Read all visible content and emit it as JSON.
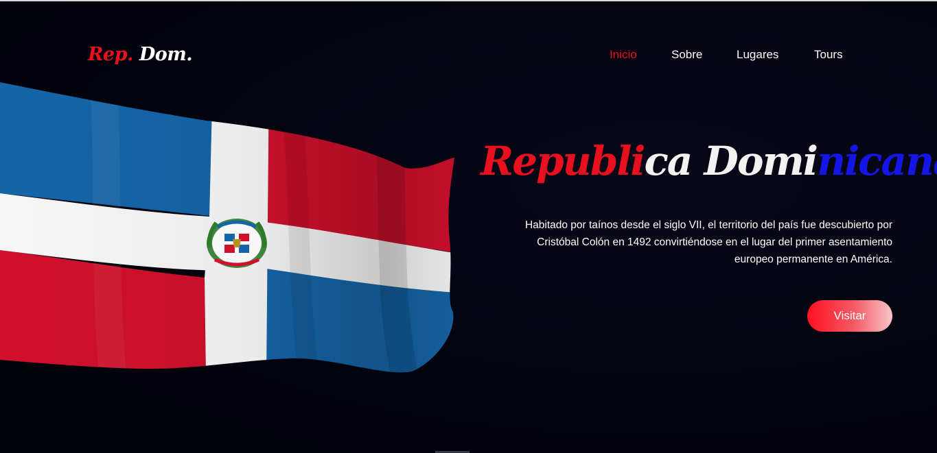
{
  "logo": {
    "part1": "Rep.",
    "part2": "Dom."
  },
  "nav": {
    "items": [
      {
        "label": "Inicio",
        "active": true
      },
      {
        "label": "Sobre",
        "active": false
      },
      {
        "label": "Lugares",
        "active": false
      },
      {
        "label": "Tours",
        "active": false
      }
    ]
  },
  "hero": {
    "title": {
      "red": "Republi",
      "white": "ca Domi",
      "blue": "nicana"
    },
    "description": "Habitado por taínos desde el siglo VII, el territorio del país fue descubierto por Cristóbal Colón en 1492 convirtiéndose en el lugar del primer asentamiento europeo permanente en América.",
    "button_label": "Visitar",
    "image": "dominican-flag-waving"
  },
  "colors": {
    "accent_red": "#e8101e",
    "accent_blue": "#1515e6",
    "flag_blue": "#1565a8",
    "flag_red": "#d0102c",
    "background": "#03030f"
  }
}
